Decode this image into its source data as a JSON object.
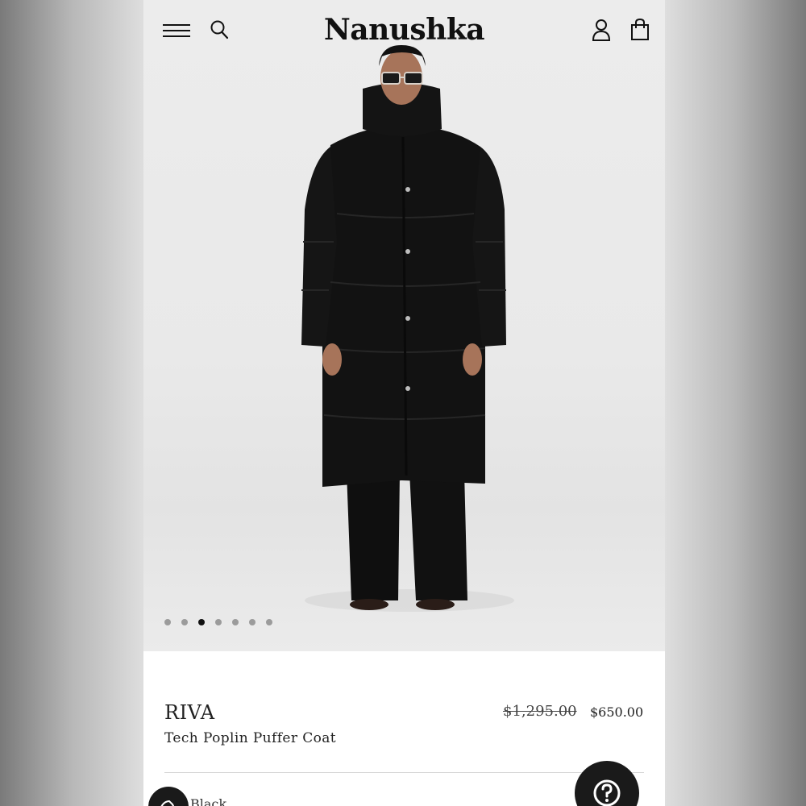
{
  "header": {
    "logo": "Nanushka",
    "icons": [
      "hamburger-menu-icon",
      "search-icon",
      "account-icon",
      "shopping-bag-icon"
    ]
  },
  "gallery": {
    "total_images": 7,
    "active_index": 2
  },
  "product": {
    "brand": "RIVA",
    "title": "Tech Poplin Puffer Coat",
    "original_price": "$1,295.00",
    "sale_price": "$650.00",
    "color": "Black"
  },
  "colors": {
    "background_page": "#ffffff",
    "hero_background": "#eaeaea",
    "text": "#222222",
    "active_dot": "#111111",
    "inactive_dot": "#9b9b9b",
    "help_button": "#1a1a1a"
  }
}
